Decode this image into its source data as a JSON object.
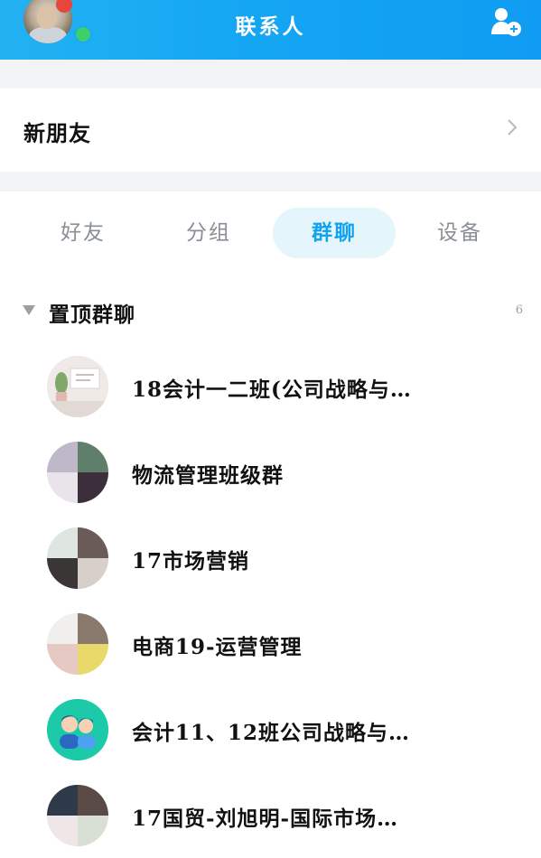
{
  "header": {
    "title": "联系人",
    "icons": {
      "avatar": "user-avatar",
      "add": "add-contact-icon"
    },
    "colors": {
      "bar": "#15a6f3",
      "notify": "#e8453c",
      "online": "#3ecf6a"
    }
  },
  "new_friends": {
    "label": "新朋友"
  },
  "tabs": [
    {
      "label": "好友",
      "active": false
    },
    {
      "label": "分组",
      "active": false
    },
    {
      "label": "群聊",
      "active": true
    },
    {
      "label": "设备",
      "active": false
    }
  ],
  "group": {
    "label": "置顶群聊",
    "count": "6"
  },
  "groups": [
    {
      "name": "18会计一二班(公司战略与…"
    },
    {
      "name": "物流管理班级群"
    },
    {
      "name": "17市场营销"
    },
    {
      "name": "电商19-运营管理"
    },
    {
      "name": "会计11、12班公司战略与…"
    },
    {
      "name": "17国贸-刘旭明-国际市场…"
    }
  ],
  "accent_color": "#12a3ef"
}
